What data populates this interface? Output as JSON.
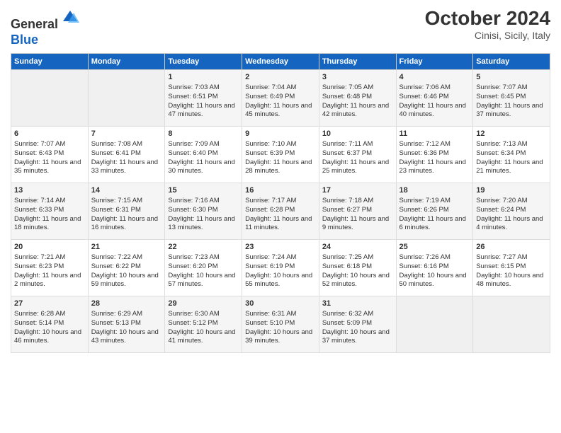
{
  "header": {
    "logo_line1": "General",
    "logo_line2": "Blue",
    "month": "October 2024",
    "location": "Cinisi, Sicily, Italy"
  },
  "weekdays": [
    "Sunday",
    "Monday",
    "Tuesday",
    "Wednesday",
    "Thursday",
    "Friday",
    "Saturday"
  ],
  "rows": [
    [
      {
        "day": "",
        "empty": true
      },
      {
        "day": "",
        "empty": true
      },
      {
        "day": "1",
        "line1": "Sunrise: 7:03 AM",
        "line2": "Sunset: 6:51 PM",
        "line3": "Daylight: 11 hours and 47 minutes."
      },
      {
        "day": "2",
        "line1": "Sunrise: 7:04 AM",
        "line2": "Sunset: 6:49 PM",
        "line3": "Daylight: 11 hours and 45 minutes."
      },
      {
        "day": "3",
        "line1": "Sunrise: 7:05 AM",
        "line2": "Sunset: 6:48 PM",
        "line3": "Daylight: 11 hours and 42 minutes."
      },
      {
        "day": "4",
        "line1": "Sunrise: 7:06 AM",
        "line2": "Sunset: 6:46 PM",
        "line3": "Daylight: 11 hours and 40 minutes."
      },
      {
        "day": "5",
        "line1": "Sunrise: 7:07 AM",
        "line2": "Sunset: 6:45 PM",
        "line3": "Daylight: 11 hours and 37 minutes."
      }
    ],
    [
      {
        "day": "6",
        "line1": "Sunrise: 7:07 AM",
        "line2": "Sunset: 6:43 PM",
        "line3": "Daylight: 11 hours and 35 minutes."
      },
      {
        "day": "7",
        "line1": "Sunrise: 7:08 AM",
        "line2": "Sunset: 6:41 PM",
        "line3": "Daylight: 11 hours and 33 minutes."
      },
      {
        "day": "8",
        "line1": "Sunrise: 7:09 AM",
        "line2": "Sunset: 6:40 PM",
        "line3": "Daylight: 11 hours and 30 minutes."
      },
      {
        "day": "9",
        "line1": "Sunrise: 7:10 AM",
        "line2": "Sunset: 6:39 PM",
        "line3": "Daylight: 11 hours and 28 minutes."
      },
      {
        "day": "10",
        "line1": "Sunrise: 7:11 AM",
        "line2": "Sunset: 6:37 PM",
        "line3": "Daylight: 11 hours and 25 minutes."
      },
      {
        "day": "11",
        "line1": "Sunrise: 7:12 AM",
        "line2": "Sunset: 6:36 PM",
        "line3": "Daylight: 11 hours and 23 minutes."
      },
      {
        "day": "12",
        "line1": "Sunrise: 7:13 AM",
        "line2": "Sunset: 6:34 PM",
        "line3": "Daylight: 11 hours and 21 minutes."
      }
    ],
    [
      {
        "day": "13",
        "line1": "Sunrise: 7:14 AM",
        "line2": "Sunset: 6:33 PM",
        "line3": "Daylight: 11 hours and 18 minutes."
      },
      {
        "day": "14",
        "line1": "Sunrise: 7:15 AM",
        "line2": "Sunset: 6:31 PM",
        "line3": "Daylight: 11 hours and 16 minutes."
      },
      {
        "day": "15",
        "line1": "Sunrise: 7:16 AM",
        "line2": "Sunset: 6:30 PM",
        "line3": "Daylight: 11 hours and 13 minutes."
      },
      {
        "day": "16",
        "line1": "Sunrise: 7:17 AM",
        "line2": "Sunset: 6:28 PM",
        "line3": "Daylight: 11 hours and 11 minutes."
      },
      {
        "day": "17",
        "line1": "Sunrise: 7:18 AM",
        "line2": "Sunset: 6:27 PM",
        "line3": "Daylight: 11 hours and 9 minutes."
      },
      {
        "day": "18",
        "line1": "Sunrise: 7:19 AM",
        "line2": "Sunset: 6:26 PM",
        "line3": "Daylight: 11 hours and 6 minutes."
      },
      {
        "day": "19",
        "line1": "Sunrise: 7:20 AM",
        "line2": "Sunset: 6:24 PM",
        "line3": "Daylight: 11 hours and 4 minutes."
      }
    ],
    [
      {
        "day": "20",
        "line1": "Sunrise: 7:21 AM",
        "line2": "Sunset: 6:23 PM",
        "line3": "Daylight: 11 hours and 2 minutes."
      },
      {
        "day": "21",
        "line1": "Sunrise: 7:22 AM",
        "line2": "Sunset: 6:22 PM",
        "line3": "Daylight: 10 hours and 59 minutes."
      },
      {
        "day": "22",
        "line1": "Sunrise: 7:23 AM",
        "line2": "Sunset: 6:20 PM",
        "line3": "Daylight: 10 hours and 57 minutes."
      },
      {
        "day": "23",
        "line1": "Sunrise: 7:24 AM",
        "line2": "Sunset: 6:19 PM",
        "line3": "Daylight: 10 hours and 55 minutes."
      },
      {
        "day": "24",
        "line1": "Sunrise: 7:25 AM",
        "line2": "Sunset: 6:18 PM",
        "line3": "Daylight: 10 hours and 52 minutes."
      },
      {
        "day": "25",
        "line1": "Sunrise: 7:26 AM",
        "line2": "Sunset: 6:16 PM",
        "line3": "Daylight: 10 hours and 50 minutes."
      },
      {
        "day": "26",
        "line1": "Sunrise: 7:27 AM",
        "line2": "Sunset: 6:15 PM",
        "line3": "Daylight: 10 hours and 48 minutes."
      }
    ],
    [
      {
        "day": "27",
        "line1": "Sunrise: 6:28 AM",
        "line2": "Sunset: 5:14 PM",
        "line3": "Daylight: 10 hours and 46 minutes."
      },
      {
        "day": "28",
        "line1": "Sunrise: 6:29 AM",
        "line2": "Sunset: 5:13 PM",
        "line3": "Daylight: 10 hours and 43 minutes."
      },
      {
        "day": "29",
        "line1": "Sunrise: 6:30 AM",
        "line2": "Sunset: 5:12 PM",
        "line3": "Daylight: 10 hours and 41 minutes."
      },
      {
        "day": "30",
        "line1": "Sunrise: 6:31 AM",
        "line2": "Sunset: 5:10 PM",
        "line3": "Daylight: 10 hours and 39 minutes."
      },
      {
        "day": "31",
        "line1": "Sunrise: 6:32 AM",
        "line2": "Sunset: 5:09 PM",
        "line3": "Daylight: 10 hours and 37 minutes."
      },
      {
        "day": "",
        "empty": true
      },
      {
        "day": "",
        "empty": true
      }
    ]
  ]
}
